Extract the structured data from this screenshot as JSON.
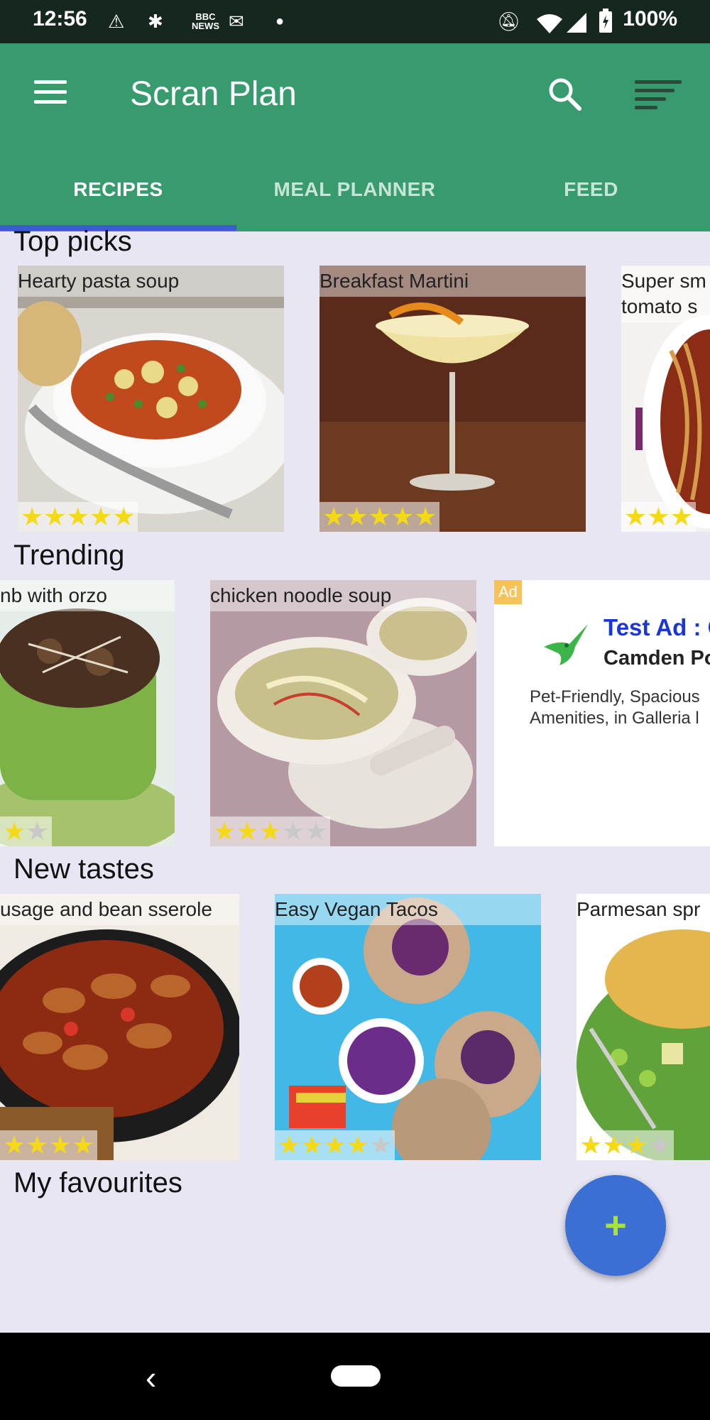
{
  "status_bar": {
    "time": "12:56",
    "battery": "100%"
  },
  "app_bar": {
    "title": "Scran Plan"
  },
  "tabs": [
    {
      "label": "RECIPES",
      "active": true
    },
    {
      "label": "MEAL PLANNER",
      "active": false
    },
    {
      "label": "FEED",
      "active": false
    }
  ],
  "sections": {
    "top_picks": {
      "title": "Top picks",
      "cards": [
        {
          "name": "Hearty pasta soup",
          "rating": 5
        },
        {
          "name": "Breakfast Martini",
          "rating": 5
        },
        {
          "name": "Super sm tomato s",
          "rating": 3
        }
      ]
    },
    "trending": {
      "title": "Trending",
      "cards": [
        {
          "name": "nb with orzo",
          "rating": 1.5
        },
        {
          "name": "chicken noodle soup",
          "rating": 3
        }
      ],
      "ad": {
        "badge": "Ad",
        "title": "Test Ad : C",
        "subtitle": "Camden Po",
        "description": "Pet-Friendly, Spacious Amenities, in Galleria l"
      }
    },
    "new_tastes": {
      "title": "New tastes",
      "cards": [
        {
          "name": "usage and bean sserole",
          "rating": 4
        },
        {
          "name": "Easy Vegan Tacos",
          "rating": 4.5
        },
        {
          "name": "Parmesan spr",
          "rating": 3.5
        }
      ]
    },
    "my_favourites": {
      "title": "My favourites"
    }
  },
  "fab": {
    "label": "+"
  },
  "colors": {
    "primary": "#389b6d",
    "indicator": "#3b5bd6",
    "fab": "#3b6fd4",
    "star": "#f4d916"
  }
}
